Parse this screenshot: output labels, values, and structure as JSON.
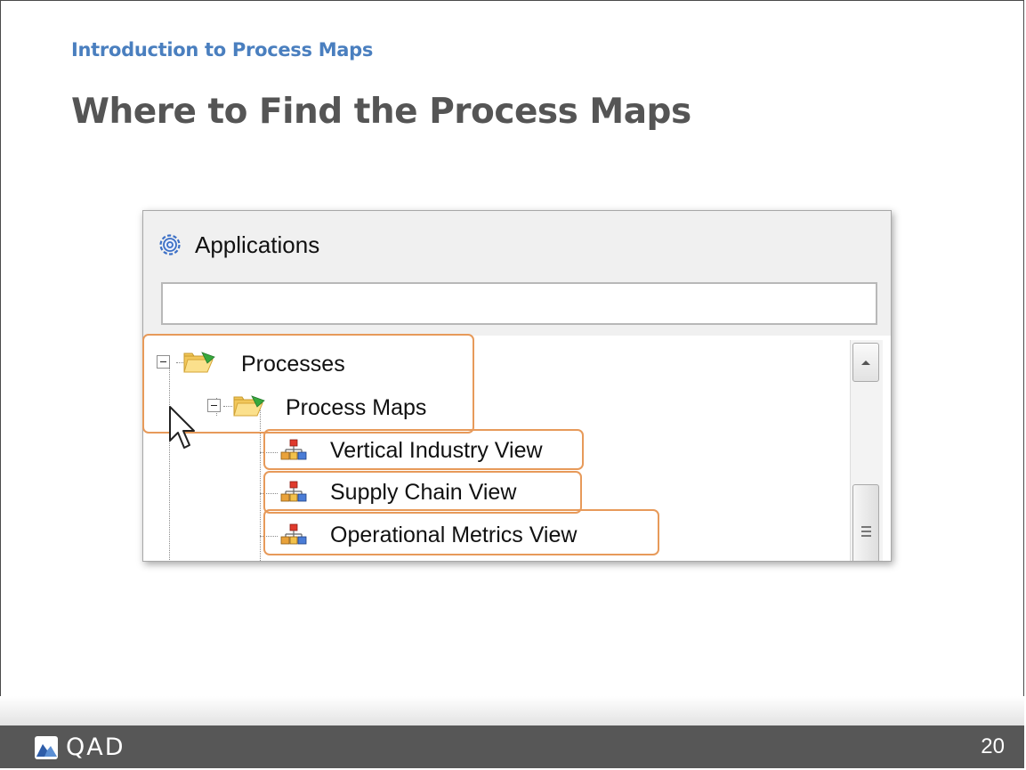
{
  "slide": {
    "subtitle": "Introduction to Process Maps",
    "title": "Where to Find the Process Maps",
    "page_number": "20"
  },
  "panel": {
    "header": "Applications",
    "header_icon": "gear-icon",
    "search_value": "",
    "tree": {
      "root": {
        "label": "Processes",
        "icon": "folder-icon",
        "expanded": true
      },
      "child": {
        "label": "Process Maps",
        "icon": "folder-icon",
        "expanded": true
      },
      "items": [
        {
          "label": "Vertical Industry View",
          "icon": "process-map-icon"
        },
        {
          "label": "Supply Chain View",
          "icon": "process-map-icon"
        },
        {
          "label": "Operational Metrics View",
          "icon": "process-map-icon"
        }
      ]
    }
  },
  "footer": {
    "logo_text": "QAD"
  },
  "colors": {
    "subtitle": "#4a7fbf",
    "title": "#555555",
    "highlight": "#e79a5a",
    "footer": "#575757"
  }
}
